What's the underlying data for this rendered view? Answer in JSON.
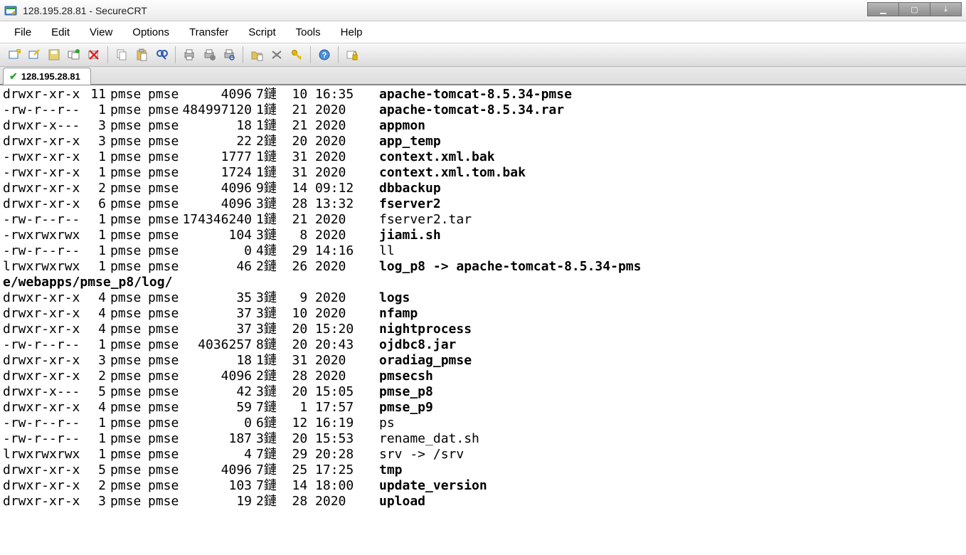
{
  "window": {
    "title": "128.195.28.81 - SecureCRT"
  },
  "menu": [
    "File",
    "Edit",
    "View",
    "Options",
    "Transfer",
    "Script",
    "Tools",
    "Help"
  ],
  "toolbar_icons": [
    "new-session-icon",
    "quick-connect-icon",
    "save-session-icon",
    "reconnect-icon",
    "disconnect-icon",
    "|",
    "copy-icon",
    "paste-icon",
    "find-icon",
    "|",
    "print-icon",
    "print-setup-icon",
    "print-preview-icon",
    "|",
    "folder-icon",
    "settings-icon",
    "key-icon",
    "|",
    "help-icon",
    "|",
    "lock-session-icon"
  ],
  "tab": {
    "label": "128.195.28.81"
  },
  "listing": [
    {
      "perm": "drwxr-xr-x",
      "links": "11",
      "user": "pmse",
      "group": "pmse",
      "size": "4096",
      "date": "7鏈  10 16:35",
      "name": "apache-tomcat-8.5.34-pmse",
      "bold": true
    },
    {
      "perm": "-rw-r--r--",
      "links": "1",
      "user": "pmse",
      "group": "pmse",
      "size": "484997120",
      "date": "1鏈  21 2020",
      "name": "apache-tomcat-8.5.34.rar",
      "bold": true
    },
    {
      "perm": "drwxr-x---",
      "links": "3",
      "user": "pmse",
      "group": "pmse",
      "size": "18",
      "date": "1鏈  21 2020",
      "name": "appmon",
      "bold": true
    },
    {
      "perm": "drwxr-xr-x",
      "links": "3",
      "user": "pmse",
      "group": "pmse",
      "size": "22",
      "date": "2鏈  20 2020",
      "name": "app_temp",
      "bold": true
    },
    {
      "perm": "-rwxr-xr-x",
      "links": "1",
      "user": "pmse",
      "group": "pmse",
      "size": "1777",
      "date": "1鏈  31 2020",
      "name": "context.xml.bak",
      "bold": true
    },
    {
      "perm": "-rwxr-xr-x",
      "links": "1",
      "user": "pmse",
      "group": "pmse",
      "size": "1724",
      "date": "1鏈  31 2020",
      "name": "context.xml.tom.bak",
      "bold": true
    },
    {
      "perm": "drwxr-xr-x",
      "links": "2",
      "user": "pmse",
      "group": "pmse",
      "size": "4096",
      "date": "9鏈  14 09:12",
      "name": "dbbackup",
      "bold": true
    },
    {
      "perm": "drwxr-xr-x",
      "links": "6",
      "user": "pmse",
      "group": "pmse",
      "size": "4096",
      "date": "3鏈  28 13:32",
      "name": "fserver2",
      "bold": true
    },
    {
      "perm": "-rw-r--r--",
      "links": "1",
      "user": "pmse",
      "group": "pmse",
      "size": "174346240",
      "date": "1鏈  21 2020",
      "name": "fserver2.tar",
      "bold": false
    },
    {
      "perm": "-rwxrwxrwx",
      "links": "1",
      "user": "pmse",
      "group": "pmse",
      "size": "104",
      "date": "3鏈   8 2020",
      "name": "jiami.sh",
      "bold": true
    },
    {
      "perm": "-rw-r--r--",
      "links": "1",
      "user": "pmse",
      "group": "pmse",
      "size": "0",
      "date": "4鏈  29 14:16",
      "name": "ll",
      "bold": false
    },
    {
      "perm": "lrwxrwxrwx",
      "links": "1",
      "user": "pmse",
      "group": "pmse",
      "size": "46",
      "date": "2鏈  26 2020",
      "name": "log_p8 -> apache-tomcat-8.5.34-pms",
      "bold": true,
      "wrap": "e/webapps/pmse_p8/log/"
    },
    {
      "perm": "drwxr-xr-x",
      "links": "4",
      "user": "pmse",
      "group": "pmse",
      "size": "35",
      "date": "3鏈   9 2020",
      "name": "logs",
      "bold": true
    },
    {
      "perm": "drwxr-xr-x",
      "links": "4",
      "user": "pmse",
      "group": "pmse",
      "size": "37",
      "date": "3鏈  10 2020",
      "name": "nfamp",
      "bold": true
    },
    {
      "perm": "drwxr-xr-x",
      "links": "4",
      "user": "pmse",
      "group": "pmse",
      "size": "37",
      "date": "3鏈  20 15:20",
      "name": "nightprocess",
      "bold": true
    },
    {
      "perm": "-rw-r--r--",
      "links": "1",
      "user": "pmse",
      "group": "pmse",
      "size": "4036257",
      "date": "8鏈  20 20:43",
      "name": "ojdbc8.jar",
      "bold": true
    },
    {
      "perm": "drwxr-xr-x",
      "links": "3",
      "user": "pmse",
      "group": "pmse",
      "size": "18",
      "date": "1鏈  31 2020",
      "name": "oradiag_pmse",
      "bold": true
    },
    {
      "perm": "drwxr-xr-x",
      "links": "2",
      "user": "pmse",
      "group": "pmse",
      "size": "4096",
      "date": "2鏈  28 2020",
      "name": "pmsecsh",
      "bold": true
    },
    {
      "perm": "drwxr-x---",
      "links": "5",
      "user": "pmse",
      "group": "pmse",
      "size": "42",
      "date": "3鏈  20 15:05",
      "name": "pmse_p8",
      "bold": true
    },
    {
      "perm": "drwxr-xr-x",
      "links": "4",
      "user": "pmse",
      "group": "pmse",
      "size": "59",
      "date": "7鏈   1 17:57",
      "name": "pmse_p9",
      "bold": true
    },
    {
      "perm": "-rw-r--r--",
      "links": "1",
      "user": "pmse",
      "group": "pmse",
      "size": "0",
      "date": "6鏈  12 16:19",
      "name": "ps",
      "bold": false
    },
    {
      "perm": "-rw-r--r--",
      "links": "1",
      "user": "pmse",
      "group": "pmse",
      "size": "187",
      "date": "3鏈  20 15:53",
      "name": "rename_dat.sh",
      "bold": false
    },
    {
      "perm": "lrwxrwxrwx",
      "links": "1",
      "user": "pmse",
      "group": "pmse",
      "size": "4",
      "date": "7鏈  29 20:28",
      "name": "srv -> /srv",
      "bold": false
    },
    {
      "perm": "drwxr-xr-x",
      "links": "5",
      "user": "pmse",
      "group": "pmse",
      "size": "4096",
      "date": "7鏈  25 17:25",
      "name": "tmp",
      "bold": true
    },
    {
      "perm": "drwxr-xr-x",
      "links": "2",
      "user": "pmse",
      "group": "pmse",
      "size": "103",
      "date": "7鏈  14 18:00",
      "name": "update_version",
      "bold": true
    },
    {
      "perm": "drwxr-xr-x",
      "links": "3",
      "user": "pmse",
      "group": "pmse",
      "size": "19",
      "date": "2鏈  28 2020",
      "name": "upload",
      "bold": true
    }
  ]
}
